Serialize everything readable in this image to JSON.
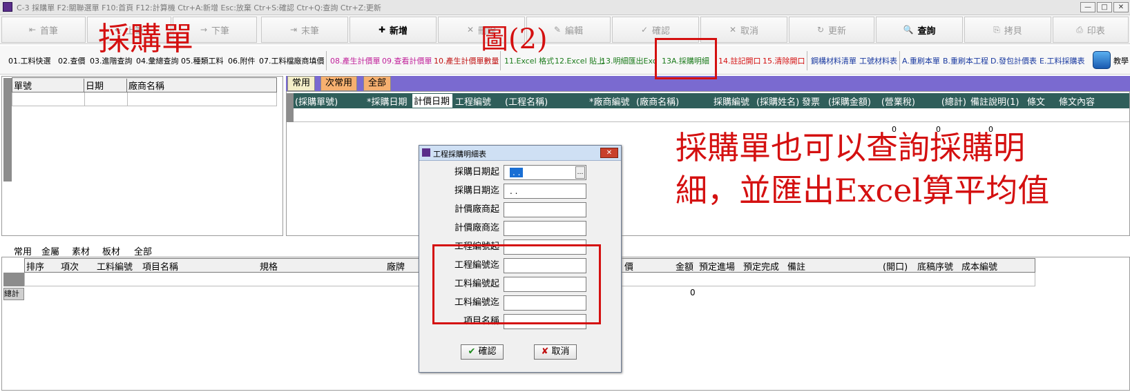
{
  "window": {
    "title": "C-3 採購單   F2:關聯選單  F10:首頁  F12:計算機  Ctr+A:新增  Esc:放棄  Ctr+S:確認  Ctr+Q:查詢  Ctr+Z:更新",
    "buttons": [
      "—",
      "□",
      "✕"
    ]
  },
  "toolbar": {
    "buttons": [
      {
        "icon": "⇤",
        "label": "首筆"
      },
      {
        "icon": "←",
        "label": "上筆"
      },
      {
        "icon": "→",
        "label": "下筆"
      },
      {
        "icon": "⇥",
        "label": "末筆"
      },
      {
        "icon": "✚",
        "label": "新增"
      },
      {
        "icon": "✕",
        "label": "刪除"
      },
      {
        "icon": "✎",
        "label": "編輯"
      },
      {
        "icon": "✓",
        "label": "確認"
      },
      {
        "icon": "✕",
        "label": "取消"
      },
      {
        "icon": "↻",
        "label": "更新"
      },
      {
        "icon": "🔍",
        "label": "查詢"
      },
      {
        "icon": "⎘",
        "label": "拷貝"
      },
      {
        "icon": "⎙",
        "label": "印表"
      }
    ]
  },
  "funcbar": {
    "group1": [
      "01.工料快選",
      "02.查價",
      "03.進階查詢",
      "04.彙總查詢",
      "05.種類工料",
      "06.附件",
      "07.工料檔廠商填價"
    ],
    "group2": [
      "08.產生計價單",
      "09.查看計價單",
      "10.產生計價單數量"
    ],
    "group3": [
      "11.Excel 格式",
      "12.Excel 貼上",
      "13.明細匯出Excel",
      "13A.採購明細"
    ],
    "group4": [
      "14.註記開口",
      "15.清除開口"
    ],
    "group5": [
      "鋼構材料清單",
      "工號材料表"
    ],
    "group6": [
      "A.重刷本單",
      "B.重刷本工程",
      "D.發包計價表",
      "E.工料採購表"
    ],
    "teach": "教學",
    "colors": {
      "group1": "#000000",
      "group2a": "#c0209a",
      "group2b": "#c0209a",
      "group2c": "#c01010",
      "group3": "#1a7a1a",
      "group4": "#d41010",
      "group5": "#1a3aa0",
      "group6": "#1a3aa0"
    }
  },
  "left_grid": {
    "headers": [
      "單號",
      "日期",
      "廠商名稱"
    ]
  },
  "top_tabs": [
    "常用",
    "次常用",
    "全部"
  ],
  "top_grid": {
    "headers": [
      "(採購單號)",
      "*採購日期",
      "計價日期",
      "工程編號",
      "(工程名稱)",
      "*廠商編號",
      "(廠商名稱)",
      "採購編號",
      "(採購姓名)",
      "發票",
      "(採購金額)",
      "(營業稅)",
      "(總計)",
      "備註說明(1)",
      "條文",
      "條文內容"
    ],
    "zeros": [
      "0",
      "0",
      "0"
    ]
  },
  "bottom_tabs": [
    "常用",
    "金屬",
    "素材",
    "板材",
    "全部"
  ],
  "bottom_grid": {
    "headers": [
      "排序",
      "項次",
      "工料編號",
      "項目名稱",
      "規格",
      "廠牌",
      "價",
      "金額",
      "預定進場",
      "預定完成",
      "備註",
      "(開口)",
      "底稿序號",
      "成本編號"
    ],
    "total_label": "總計",
    "total_value": "0"
  },
  "dialog": {
    "title": "工程採購明細表",
    "fields": [
      {
        "label": "採購日期起",
        "value": ". ."
      },
      {
        "label": "採購日期迄",
        "value": ". ."
      },
      {
        "label": "計價廠商起",
        "value": ""
      },
      {
        "label": "計價廠商迄",
        "value": ""
      },
      {
        "label": "工程編號起",
        "value": ""
      },
      {
        "label": "工程編號迄",
        "value": ""
      },
      {
        "label": "工料編號起",
        "value": ""
      },
      {
        "label": "工料編號迄",
        "value": ""
      },
      {
        "label": "項目名稱",
        "value": ""
      }
    ],
    "ok_label": "確認",
    "cancel_label": "取消"
  },
  "annotations": {
    "title": "採購單",
    "figure": "圖(2)",
    "line1": "採購單也可以查詢採購明",
    "line2": "細，並匯出Excel算平均值",
    "color": "#d41010"
  }
}
